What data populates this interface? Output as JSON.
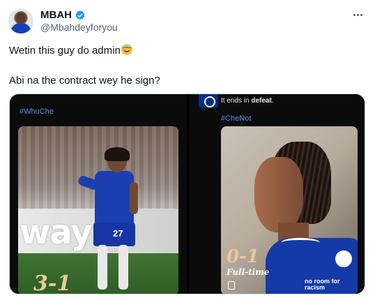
{
  "user": {
    "display_name": "MBAH",
    "handle": "@Mbahdeyforyou",
    "verified": true,
    "verified_color": "#1d9bf0",
    "avatar_icon": "profile-avatar"
  },
  "tweet": {
    "line1": "Wetin this guy do admin",
    "line1_emoji": "face-with-tears-of-joy",
    "line2": "Abi na the contract wey he sign?"
  },
  "media": {
    "left": {
      "hashtag": "#WhuChe",
      "board_text": "way",
      "shirt_number": "27",
      "score": "3-1"
    },
    "right": {
      "badge_icon": "chelsea-crest-icon",
      "ends_prefix": "It ends in ",
      "ends_bold": "defeat",
      "ends_suffix": ".",
      "hashtag": "#CheNot",
      "score": "0-1",
      "status": "Full-time",
      "sponsor": "no room for racism"
    }
  },
  "colors": {
    "link": "#4f93e8",
    "text": "#0f1419",
    "muted": "#536471",
    "score": "#e8c89d"
  }
}
